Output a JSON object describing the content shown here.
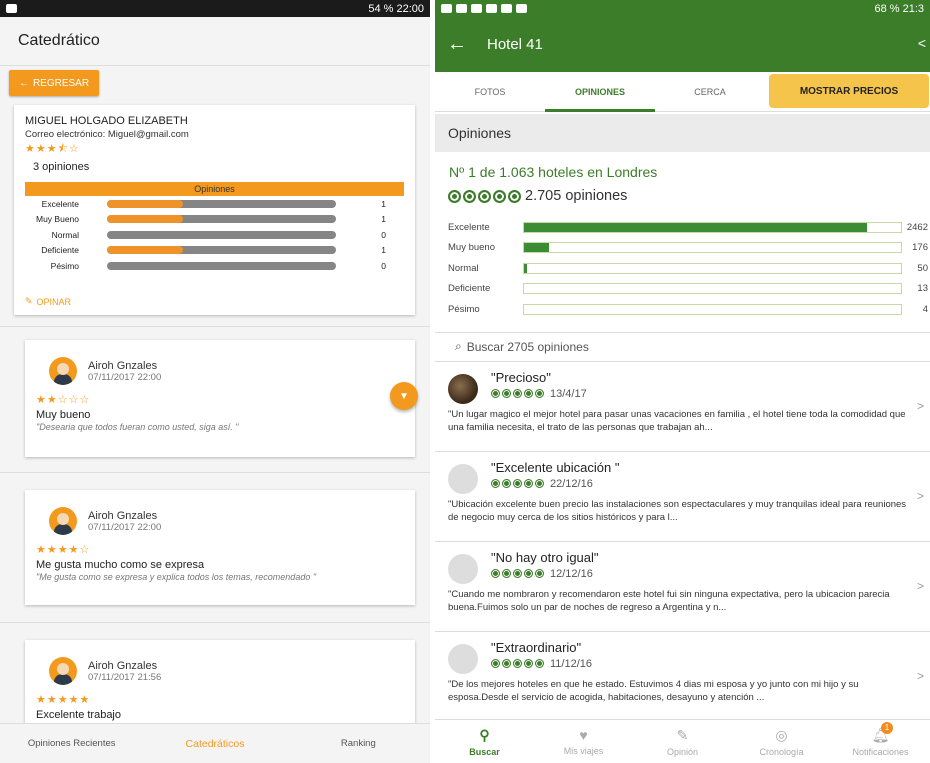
{
  "left": {
    "status_time": "54 % 22:00",
    "title": "Catedrático",
    "back_label": "REGRESAR",
    "profile": {
      "name": "MIGUEL HOLGADO ELIZABETH",
      "email": "Correo electrónico: Miguel@gmail.com",
      "stars": "★★★⯪☆",
      "opinions_count": "3 opiniones",
      "breakdown_title": "Opiniones",
      "breakdown": [
        {
          "label": "Excelente",
          "value": "1",
          "fraction": 0.33
        },
        {
          "label": "Muy Bueno",
          "value": "1",
          "fraction": 0.33
        },
        {
          "label": "Normal",
          "value": "0",
          "fraction": 0
        },
        {
          "label": "Deficiente",
          "value": "1",
          "fraction": 0.33
        },
        {
          "label": "Pésimo",
          "value": "0",
          "fraction": 0
        }
      ],
      "opinar_label": "OPINAR"
    },
    "reviews": [
      {
        "name": "Airoh Gnzales",
        "date": "07/11/2017 22:00",
        "stars": "★★☆☆☆",
        "title": "Muy bueno",
        "body": "\"Desearia que todos fueran como usted, siga así. \""
      },
      {
        "name": "Airoh Gnzales",
        "date": "07/11/2017 22:00",
        "stars": "★★★★☆",
        "title": "Me gusta mucho como se expresa",
        "body": "\"Me gusta como se expresa y explica todos los temas, recomendado \""
      },
      {
        "name": "Airoh Gnzales",
        "date": "07/11/2017 21:56",
        "stars": "★★★★★",
        "title": "Excelente trabajo",
        "body": ""
      }
    ],
    "nav": {
      "recent": "Opiniones Recientes",
      "catedraticos": "Catedráticos",
      "ranking": "Ranking"
    }
  },
  "right": {
    "status_time": "68 % 21:3",
    "title": "Hotel 41",
    "tabs": {
      "fotos": "FOTOS",
      "opiniones": "OPINIONES",
      "cerca": "CERCA"
    },
    "price_button": "MOSTRAR PRECIOS",
    "section": "Opiniones",
    "ranking": "Nº 1 de 1.063 hoteles en Londres",
    "total": "2.705 opiniones",
    "breakdown": [
      {
        "label": "Excelente",
        "value": "2462",
        "fraction": 0.91
      },
      {
        "label": "Muy bueno",
        "value": "176",
        "fraction": 0.065
      },
      {
        "label": "Normal",
        "value": "50",
        "fraction": 0.006
      },
      {
        "label": "Deficiente",
        "value": "13",
        "fraction": 0
      },
      {
        "label": "Pésimo",
        "value": "4",
        "fraction": 0
      }
    ],
    "search_placeholder": "Buscar 2705 opiniones",
    "reviews": [
      {
        "title": "\"Precioso\"",
        "date": "13/4/17",
        "body": "\"Un lugar magico el mejor hotel para pasar unas vacaciones en familia , el hotel tiene toda la comodidad que una familia necesita, el trato de las personas que trabajan ah..."
      },
      {
        "title": "\"Excelente ubicación \"",
        "date": "22/12/16",
        "body": "\"Ubicación excelente buen precio las instalaciones son espectaculares y muy tranquilas ideal para reuniones de negocio muy cerca de los sitios históricos y para l..."
      },
      {
        "title": "\"No hay otro igual\"",
        "date": "12/12/16",
        "body": "\"Cuando me nombraron y recomendaron este hotel fui sin ninguna expectativa, pero la ubicacion parecia buena.Fuimos solo un par de noches de regreso a Argentina y n..."
      },
      {
        "title": "\"Extraordinario\"",
        "date": "11/12/16",
        "body": "\"De los mejores hoteles en que he estado. Estuvimos 4 dias mi esposa y yo junto con mi hijo y su esposa.Desde el servicio de acogida, habitaciones, desayuno y atención ..."
      }
    ],
    "nav": {
      "buscar": "Buscar",
      "viajes": "Mis viajes",
      "opinion": "Opinión",
      "cronologia": "Cronología",
      "notificaciones": "Notificaciones",
      "badge": "1"
    }
  }
}
